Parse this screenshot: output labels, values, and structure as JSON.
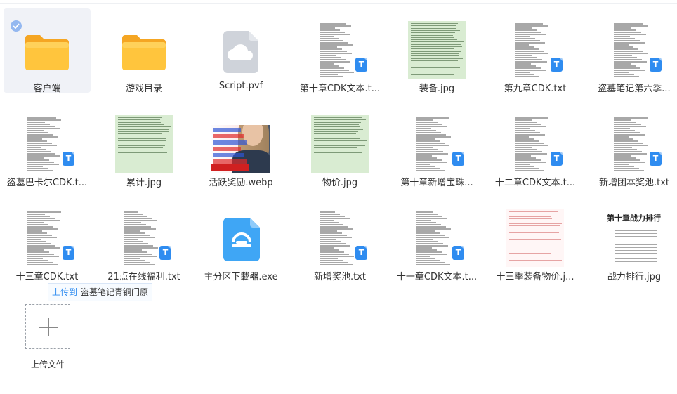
{
  "files": [
    {
      "name": "客户端",
      "kind": "folder",
      "selected": true
    },
    {
      "name": "游戏目录",
      "kind": "folder"
    },
    {
      "name": "Script.pvf",
      "kind": "cloud"
    },
    {
      "name": "第十章CDK文本.t...",
      "kind": "text"
    },
    {
      "name": "装备.jpg",
      "kind": "image-green"
    },
    {
      "name": "第九章CDK.txt",
      "kind": "text"
    },
    {
      "name": "盗墓笔记第六季...",
      "kind": "text"
    },
    {
      "name": "盗墓巴卡尔CDK.t...",
      "kind": "text"
    },
    {
      "name": "累计.jpg",
      "kind": "image-green"
    },
    {
      "name": "活跃奖励.webp",
      "kind": "image-photo"
    },
    {
      "name": "物价.jpg",
      "kind": "image-green"
    },
    {
      "name": "第十章新增宝珠...",
      "kind": "text"
    },
    {
      "name": "十二章CDK文本.t...",
      "kind": "text"
    },
    {
      "name": "新增团本奖池.txt",
      "kind": "text"
    },
    {
      "name": "十三章CDK.txt",
      "kind": "text"
    },
    {
      "name": "21点在线福利.txt",
      "kind": "text"
    },
    {
      "name": "主分区下載器.exe",
      "kind": "exe"
    },
    {
      "name": "新增奖池.txt",
      "kind": "text"
    },
    {
      "name": "十一章CDK文本.t...",
      "kind": "text"
    },
    {
      "name": "十三季装备物价.j...",
      "kind": "image-pink"
    },
    {
      "name": "战力排行.jpg",
      "kind": "image-ranking"
    }
  ],
  "ranking_title": "第十章战力排行",
  "tooltip": {
    "prefix": "上传到",
    "destination": "盗墓笔记青铜门原"
  },
  "upload": {
    "label": "上传文件"
  },
  "icons": {
    "folder": "folder-icon",
    "cloud": "cloud-file-icon",
    "exe": "installer-icon",
    "text_badge": "T",
    "select_check": "check-icon",
    "upload": "plus-icon"
  },
  "colors": {
    "accent": "#2f8cf0",
    "folder": "#ffc53d",
    "selected_bg": "#f0f2f7",
    "exe": "#3fa6f5"
  }
}
